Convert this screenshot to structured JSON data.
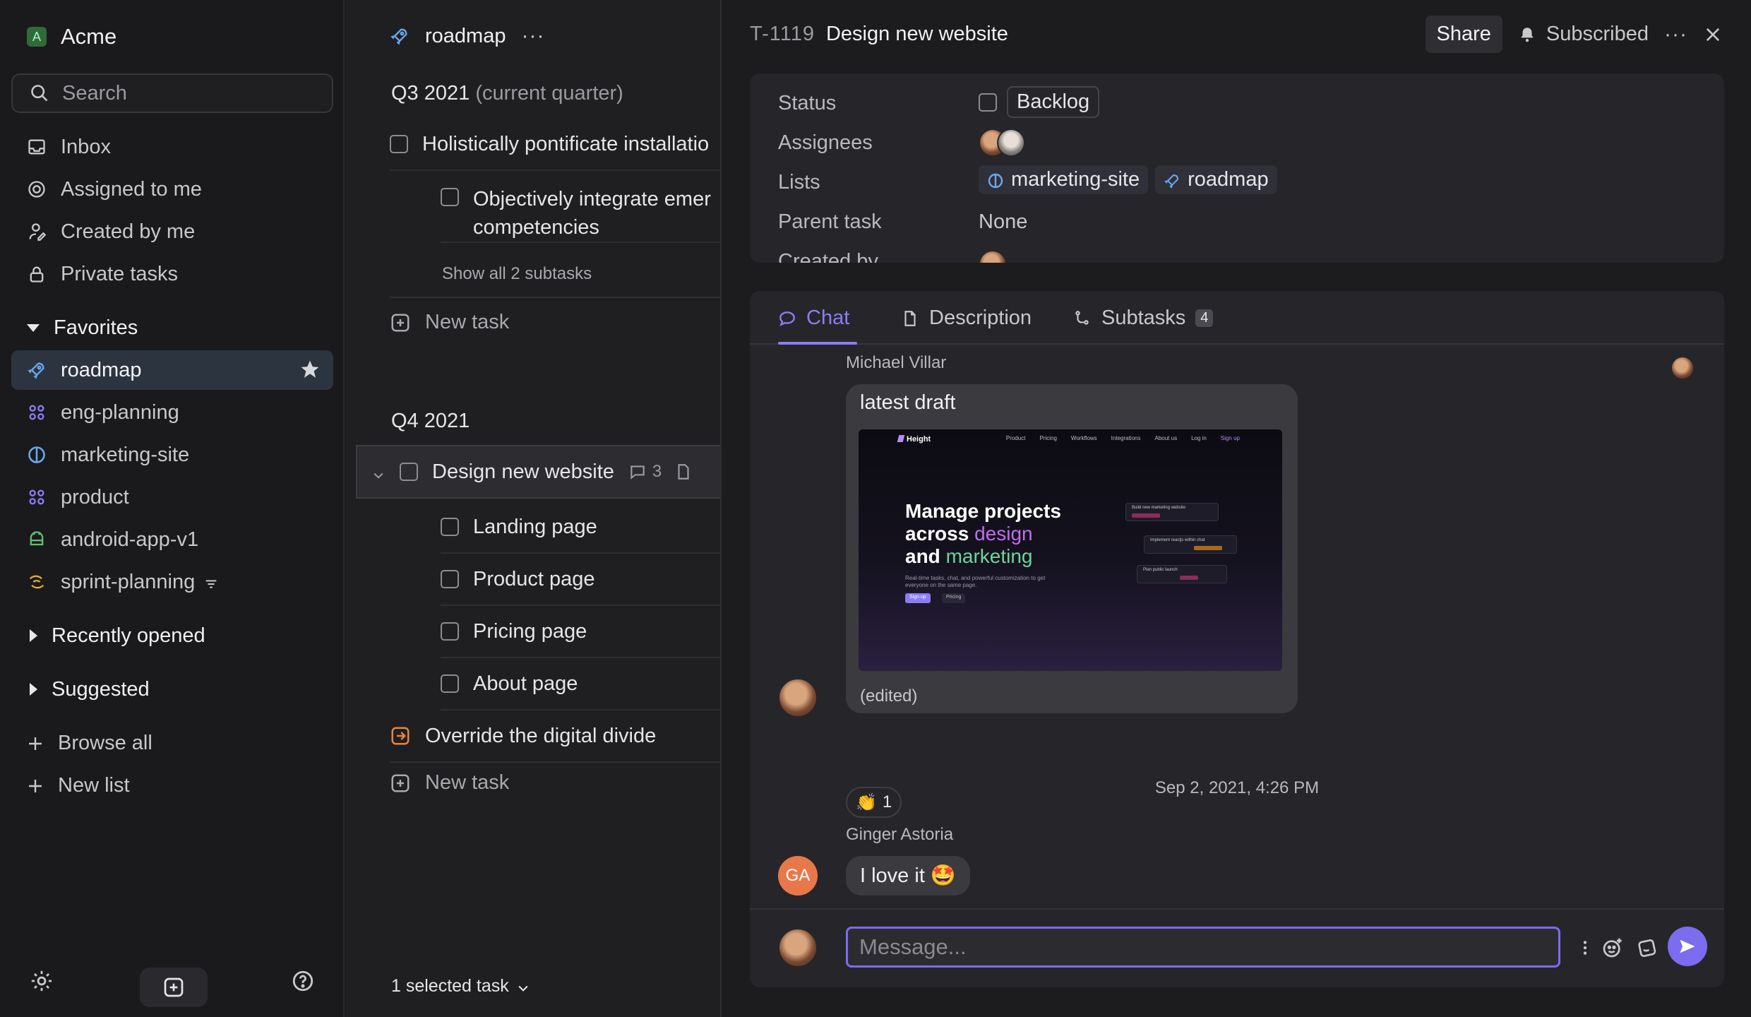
{
  "sidebar": {
    "workspace_initial": "A",
    "workspace_name": "Acme",
    "search_placeholder": "Search",
    "nav": {
      "inbox": "Inbox",
      "assigned": "Assigned to me",
      "created": "Created by me",
      "private": "Private tasks"
    },
    "favorites_label": "Favorites",
    "favorites": [
      {
        "label": "roadmap",
        "icon": "rocket-icon",
        "color": "#6aa8f0"
      },
      {
        "label": "eng-planning",
        "icon": "grid-icon",
        "color": "#8b7cf6"
      },
      {
        "label": "marketing-site",
        "icon": "half-circle-icon",
        "color": "#6aa8f0"
      },
      {
        "label": "product",
        "icon": "grid-icon",
        "color": "#8b7cf6"
      },
      {
        "label": "android-app-v1",
        "icon": "android-icon",
        "color": "#5cc36e"
      },
      {
        "label": "sprint-planning",
        "icon": "loop-icon",
        "color": "#e8a83a"
      }
    ],
    "recently_opened": "Recently opened",
    "suggested": "Suggested",
    "browse_all": "Browse all",
    "new_list": "New list"
  },
  "list": {
    "title": "roadmap",
    "q3_title": "Q3 2021",
    "q3_note": "(current quarter)",
    "q3_task": "Holistically pontificate installatio",
    "q3_subtask_1": "Objectively integrate emer",
    "q3_subtask_2": "competencies",
    "show_all": "Show all 2 subtasks",
    "new_task": "New task",
    "q4_title": "Q4 2021",
    "selected_task": "Design new website",
    "selected_comments": "3",
    "subtasks": [
      "Landing page",
      "Product page",
      "Pricing page",
      "About page"
    ],
    "override_task": "Override the digital divide",
    "selected_count": "1 selected task"
  },
  "detail": {
    "task_id": "T-1119",
    "title": "Design new website",
    "share": "Share",
    "subscribed": "Subscribed",
    "props": {
      "status_label": "Status",
      "status_value": "Backlog",
      "assignees_label": "Assignees",
      "lists_label": "Lists",
      "list_1": "marketing-site",
      "list_2": "roadmap",
      "parent_label": "Parent task",
      "parent_value": "None",
      "created_label": "Created by"
    },
    "tabs": {
      "chat": "Chat",
      "description": "Description",
      "subtasks": "Subtasks",
      "subtasks_count": "4"
    },
    "messages": [
      {
        "sender": "Michael Villar",
        "text": "latest draft",
        "edited": "(edited)",
        "reaction": "👏",
        "reaction_count": "1"
      },
      {
        "sender": "Ginger Astoria",
        "initials": "GA",
        "text": "I love it 🤩"
      }
    ],
    "date_separator": "Sep 2, 2021, 4:26 PM",
    "composer_placeholder": "Message...",
    "preview": {
      "brand": "Height",
      "nav": [
        "Product",
        "Pricing",
        "Workflows",
        "Integrations",
        "About us",
        "Log in",
        "Sign up"
      ],
      "headline_1": "Manage projects",
      "headline_2a": "across ",
      "headline_2b": "design",
      "headline_3a": "and ",
      "headline_3b": "marketing",
      "sub": "Real-time tasks, chat, and powerful customization to get everyone on the same page.",
      "btn_primary": "Sign up",
      "btn_secondary": "Pricing",
      "card_1": "Build new marketing website",
      "card_2": "Implement reactjs within chat",
      "card_3": "Plan public launch"
    }
  },
  "colors": {
    "accent": "#7b6cf0",
    "active_nav_bg": "#2c3440"
  }
}
